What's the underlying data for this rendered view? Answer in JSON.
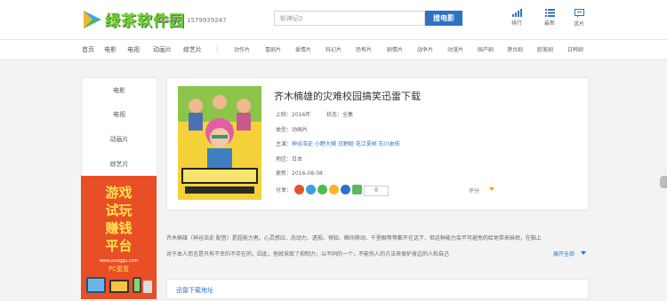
{
  "brand": {
    "name": "绿茶软件园",
    "qq": "联系QQ：1579939247"
  },
  "search": {
    "placeholder": "斩神记2",
    "button_label": "搜电影"
  },
  "top_icons": [
    {
      "label": "排行",
      "icon": "ranking-icon"
    },
    {
      "label": "最新",
      "icon": "list-icon"
    },
    {
      "label": "求片",
      "icon": "message-icon"
    }
  ],
  "nav": {
    "main": [
      "首页",
      "电影",
      "电视",
      "动画片",
      "综艺片"
    ],
    "sub": [
      "动作片",
      "喜剧片",
      "爱情片",
      "科幻片",
      "恐怖片",
      "剧情片",
      "战争片",
      "动漫片",
      "国产剧",
      "港台剧",
      "欧美剧",
      "日韩剧"
    ]
  },
  "sidebar": {
    "items": [
      "电影",
      "电视",
      "动画片",
      "综艺片"
    ]
  },
  "ad": {
    "line1": "游戏",
    "line2": "试玩",
    "line3": "赚钱",
    "line4": "平台",
    "url": "www.pceggs.com",
    "name": "PC蛋蛋"
  },
  "movie": {
    "title": "齐木楠雄的灾难校园搞笑迅雷下载",
    "year": "上映：2016年",
    "status": "状态：全集",
    "type": "类型：动画片",
    "cast_label": "主演：",
    "cast": "神谷浩史 小野大辅 日野聪 花江夏树 石川由依",
    "region": "地区：日本",
    "updated": "更新：2016-08-08",
    "share_label": "分享：",
    "share_count": "0",
    "rating_label": "评分"
  },
  "description": {
    "line1": "齐木楠雄（神谷浩史 配音）是超能力者。心灵感应、念动力、透视、预知、瞬间移动、千里眼等等都不在话下，但这种能力会不可避免的给他带来麻烦，在脑上",
    "line2": "对于本人而言是只有不幸的不存在的，因此，他就采取了抑制力，以不同的一个，不能伤人的方法来保护身边的人和自己",
    "expand_label": "展开全部"
  },
  "download": {
    "title": "迅雷下载地址"
  },
  "colors": {
    "accent": "#2d72c2",
    "link": "#2f73c5",
    "logo": "#7bd33b",
    "ad_bg": "#e94f26",
    "ad_text": "#ffe24d"
  }
}
